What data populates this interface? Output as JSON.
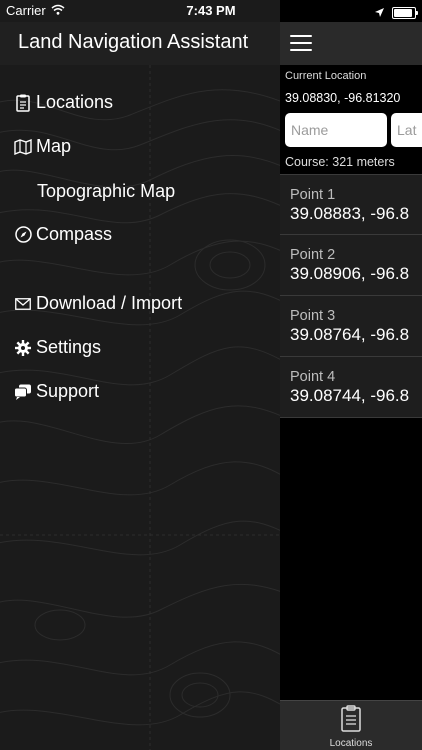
{
  "status_bar": {
    "carrier": "Carrier",
    "time": "7:43 PM"
  },
  "drawer": {
    "title": "Land Navigation Assistant",
    "menu": [
      {
        "label": "Locations",
        "icon": "clipboard-icon"
      },
      {
        "label": "Map",
        "icon": "map-icon"
      },
      {
        "label": "Topographic Map"
      },
      {
        "label": "Compass",
        "icon": "compass-icon"
      },
      {
        "label": "Download / Import",
        "icon": "envelope-icon"
      },
      {
        "label": "Settings",
        "icon": "gear-icon"
      },
      {
        "label": "Support",
        "icon": "chat-bubbles-icon"
      }
    ]
  },
  "main": {
    "current_location_label": "Current Location",
    "current_location": "39.08830, -96.81320",
    "name_placeholder": "Name",
    "lat_placeholder": "Lat",
    "course": "Course: 321 meters",
    "points": [
      {
        "name": "Point 1",
        "coords": "39.08883, -96.8"
      },
      {
        "name": "Point 2",
        "coords": "39.08906, -96.8"
      },
      {
        "name": "Point 3",
        "coords": "39.08764, -96.8"
      },
      {
        "name": "Point 4",
        "coords": "39.08744, -96.8"
      }
    ]
  },
  "tabbar": {
    "tab_label": "Locations",
    "tab_icon": "clipboard-icon"
  },
  "colors": {
    "drawer_bg": "#1b1b1b",
    "header_bg": "#202020",
    "row_bg": "#1e1e1e",
    "accent": "#ffffff"
  }
}
